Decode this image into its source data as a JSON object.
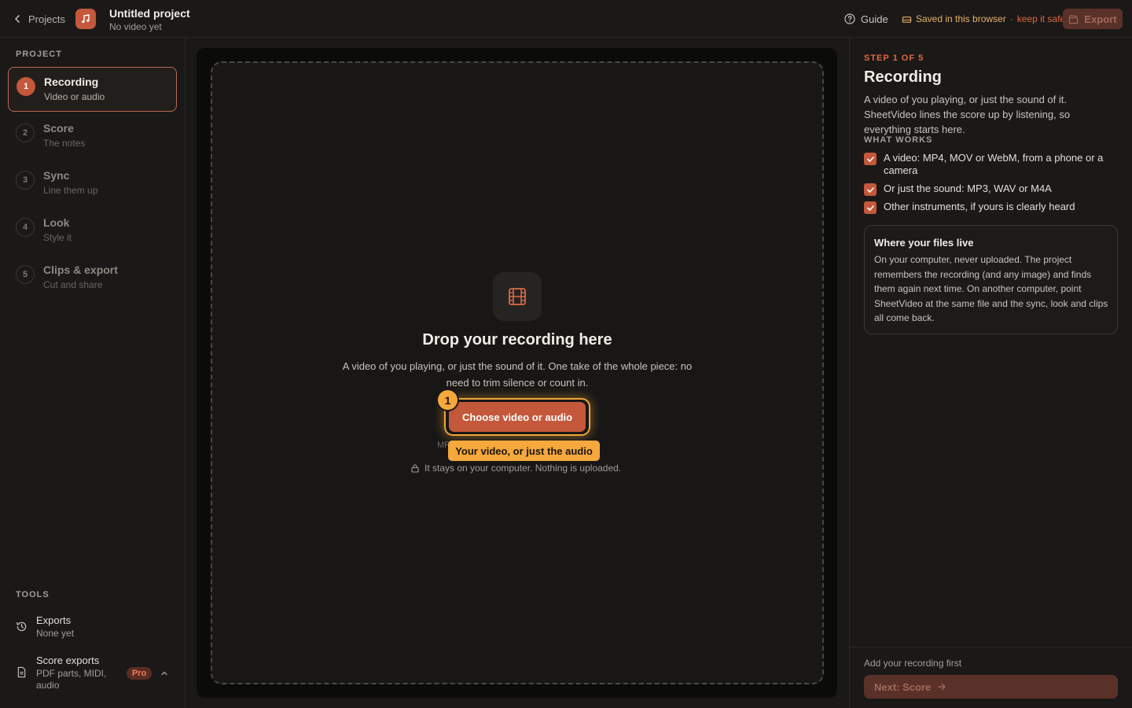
{
  "topbar": {
    "back_label": "Projects",
    "project_title": "Untitled project",
    "project_subtitle": "No video yet",
    "guide_label": "Guide",
    "saved_label": "Saved in this browser",
    "saved_separator": "·",
    "keep_safe_label": "keep it safe",
    "export_label": "Export"
  },
  "sidebar": {
    "project_heading": "PROJECT",
    "steps": [
      {
        "num": "1",
        "title": "Recording",
        "sub": "Video or audio",
        "active": true
      },
      {
        "num": "2",
        "title": "Score",
        "sub": "The notes"
      },
      {
        "num": "3",
        "title": "Sync",
        "sub": "Line them up"
      },
      {
        "num": "4",
        "title": "Look",
        "sub": "Style it"
      },
      {
        "num": "5",
        "title": "Clips & export",
        "sub": "Cut and share"
      }
    ],
    "tools_heading": "TOOLS",
    "tools": [
      {
        "title": "Exports",
        "sub": "None yet",
        "icon": "history-icon"
      },
      {
        "title": "Score exports",
        "sub": "PDF parts, MIDI, audio",
        "icon": "document-icon",
        "badge": "Pro"
      }
    ]
  },
  "dropzone": {
    "icon": "film-icon",
    "title": "Drop your recording here",
    "description": "A video of you playing, or just the sound of it. One take of the whole piece: no need to trim silence or count in.",
    "choose_label": "Choose video or audio",
    "step_badge": "1",
    "formats_partial": "MP",
    "tooltip": "Your video, or just the audio",
    "privacy_note": "It stays on your computer. Nothing is uploaded."
  },
  "panel": {
    "kicker": "STEP 1 OF 5",
    "title": "Recording",
    "description": "A video of you playing, or just the sound of it. SheetVideo lines the score up by listening, so everything starts here.",
    "works_heading": "WHAT WORKS",
    "works": [
      "A video: MP4, MOV or WebM, from a phone or a camera",
      "Or just the sound: MP3, WAV or M4A",
      "Other instruments, if yours is clearly heard"
    ],
    "files_card": {
      "title": "Where your files live",
      "body": "On your computer, never uploaded. The project remembers the recording (and any image) and finds them again next time. On another computer, point SheetVideo at the same file and the sync, look and clips all come back."
    },
    "footer_hint": "Add your recording first",
    "next_label": "Next: Score"
  },
  "colors": {
    "accent": "#c4583a",
    "highlight": "#f5a83c",
    "saved_text": "#e9b06a",
    "link": "#e2673e",
    "background": "#1a1918"
  }
}
